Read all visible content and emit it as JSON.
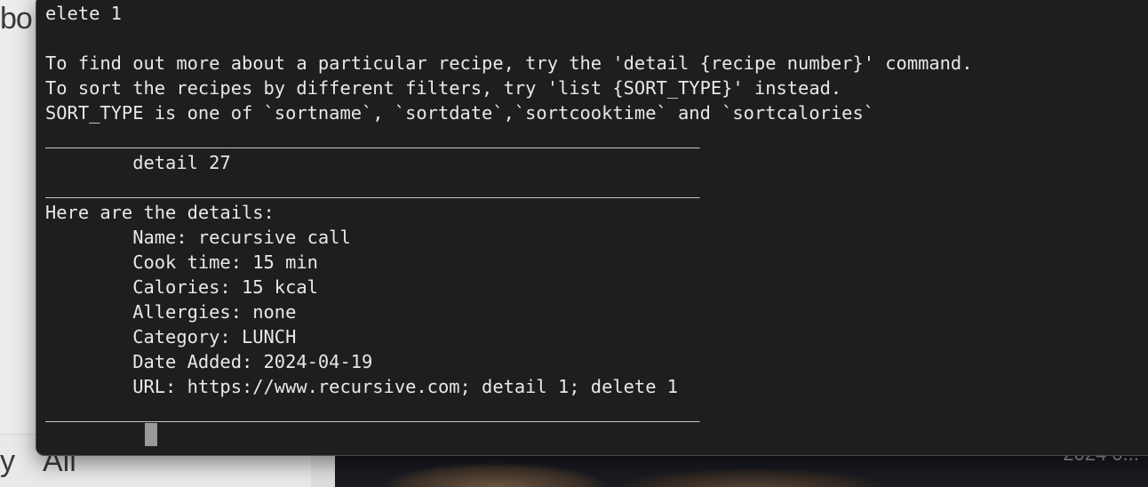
{
  "background": {
    "left_fragment_top": "bo",
    "left_fragment_bottom_1": "y",
    "left_fragment_bottom_2": "All",
    "right_date_fragment": "2024 0..."
  },
  "terminal": {
    "lines": [
      "elete 1",
      "",
      "To find out more about a particular recipe, try the 'detail {recipe number}' command.",
      "To sort the recipes by different filters, try 'list {SORT_TYPE}' instead.",
      "SORT_TYPE is one of `sortname`, `sortdate`,`sortcooktime` and `sortcalories`",
      "____________________________________________________________",
      "        detail 27",
      "____________________________________________________________",
      "Here are the details:",
      "        Name: recursive call",
      "        Cook time: 15 min",
      "        Calories: 15 kcal",
      "        Allergies: none",
      "        Category: LUNCH",
      "        Date Added: 2024-04-19",
      "        URL: https://www.recursive.com; detail 1; delete 1",
      "____________________________________________________________"
    ]
  },
  "colors": {
    "terminal_bg": "#1e1e1e",
    "terminal_text": "#e8e8e8",
    "cursor": "#9a9a9a"
  }
}
